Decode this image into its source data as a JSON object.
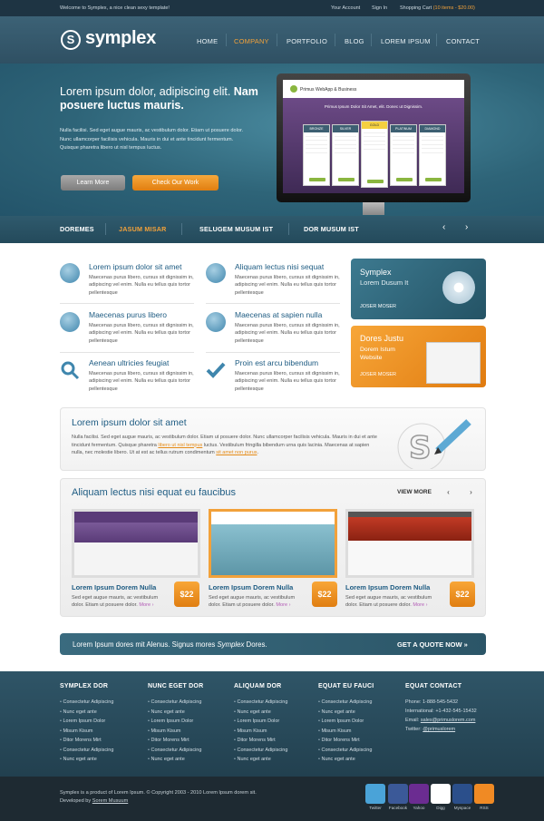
{
  "topbar": {
    "welcome": "Welcome to Symplex, a nice clean sexy template!",
    "my_account": "Your Account",
    "sign_in": "Sign In",
    "cart_label": "Shopping Cart",
    "cart_info": "(10 items - $20.00)"
  },
  "brand": {
    "name": "symplex",
    "mark": "S"
  },
  "nav": {
    "items": [
      "HOME",
      "COMPANY",
      "PORTFOLIO",
      "BLOG",
      "LOREM IPSUM",
      "CONTACT"
    ],
    "active": "COMPANY"
  },
  "hero": {
    "title_plain": "Lorem ipsum dolor, adipiscing elit.",
    "title_bold": "Nam posuere luctus mauris.",
    "body": "Nulla facilisi. Sed eget augue mauris, ac vestibulum dolor. Etiam ut posuere dolor. Nunc ullamcorper facilisis vehicula. Mauris in dui et ante tincidunt fermentum. Quisque pharetra libero ut nisl tempus luctus.",
    "learn_more": "Learn More",
    "check_work": "Check Our Work"
  },
  "screen": {
    "logo": "Primus WebApp & Business",
    "headline": "Primus Ipsum Dolor Sit Amet, elit. Donec ut Dignissim.",
    "plans": [
      "BRONZE",
      "SILVER",
      "GOLD",
      "PLATINUM",
      "DIAMOND"
    ]
  },
  "tabs": {
    "items": [
      "DOREMES",
      "JASUM MISAR",
      "SELUGEM MUSUM IST",
      "DOR MUSUM IST"
    ],
    "active": "JASUM MISAR"
  },
  "features": [
    {
      "title": "Lorem ipsum dolor sit amet",
      "text": "Maecenas purus libero, cursus sit dignissim in, adipiscing vel enim. Nulla eu tellus quis tortor pellentesque",
      "icon": "globe-icon"
    },
    {
      "title": "Aliquam lectus nisi sequat",
      "text": "Maecenas purus libero, cursus sit dignissim in, adipiscing vel enim. Nulla eu tellus quis tortor pellentesque",
      "icon": "download-icon"
    },
    {
      "title": "Maecenas purus libero",
      "text": "Maecenas purus libero, cursus sit dignissim in, adipiscing vel enim. Nulla eu tellus quis tortor pellentesque",
      "icon": "users-icon"
    },
    {
      "title": "Maecenas at sapien nulla",
      "text": "Maecenas purus libero, cursus sit dignissim in, adipiscing vel enim. Nulla eu tellus quis tortor pellentesque",
      "icon": "bug-icon"
    },
    {
      "title": "Aenean ultricies feugiat",
      "text": "Maecenas purus libero, cursus sit dignissim in, adipiscing vel enim. Nulla eu tellus quis tortor pellentesque",
      "icon": "search-icon"
    },
    {
      "title": "Proin est arcu bibendum",
      "text": "Maecenas purus libero, cursus sit dignissim in, adipiscing vel enim. Nulla eu tellus quis tortor pellentesque",
      "icon": "check-icon"
    }
  ],
  "promos": [
    {
      "title": "Symplex",
      "subtitle": "Lorem Dusum It",
      "author": "JOSER MOSER",
      "color": "#2e6a80"
    },
    {
      "title": "Dores Justu",
      "subtitle": "Dorem Istum Website",
      "author": "JOSER MOSER",
      "color": "#e88a1b"
    }
  ],
  "lorem": {
    "title": "Lorem ipsum dolor sit amet",
    "text_a": "Nulla facilisi. Sed eget augue mauris, ac vestibulum dolor. Etiam ut posuere dolor. Nunc ullamcorper facilisis vehicula. Mauris in dui et ante tincidunt fermentum. Quisque pharetra ",
    "link_a": "libero ut nisl tempus",
    "text_b": " luctus. Vestibulum fringilla bibendum urna quis lacinia. Maecenas at sapien nulla, nec molestie libero. Ut at est ac tellus rutrum condimentum ",
    "link_b": "sit amet non purus",
    "text_c": "."
  },
  "portfolio": {
    "title": "Aliquam lectus nisi equat eu faucibus",
    "view_more": "VIEW MORE",
    "items": [
      {
        "title": "Lorem Ipsum Dorem Nulla",
        "text": "Sed eget augue mauris, ac vestibulum dolor. Etiam ut posuere dolor.",
        "more": "More ›",
        "price": "$22"
      },
      {
        "title": "Lorem Ipsum Dorem Nulla",
        "text": "Sed eget augue mauris, ac vestibulum dolor. Etiam ut posuere dolor.",
        "more": "More ›",
        "price": "$22"
      },
      {
        "title": "Lorem Ipsum Dorem Nulla",
        "text": "Sed eget augue mauris, ac vestibulum dolor. Etiam ut posuere dolor.",
        "more": "More ›",
        "price": "$22"
      }
    ]
  },
  "cta": {
    "text_a": "Lorem Ipsum dores mit Alenus. Signus mores ",
    "text_em": "Symplex",
    "text_b": " Dores.",
    "button": "GET A QUOTE NOW »"
  },
  "footer": {
    "columns": [
      {
        "heading": "SYMPLEX DOR",
        "items": [
          "Consectetur Adipiscing",
          "Nunc eget ante",
          "Lorem Ipsum Dolor",
          "Misum Kisum",
          "Ditor Morens Mirt",
          "Consectetur Adipiscing",
          "Nunc eget ante"
        ]
      },
      {
        "heading": "NUNC EGET DOR",
        "items": [
          "Consectetur Adipiscing",
          "Nunc eget ante",
          "Lorem Ipsum Dolor",
          "Misum Kisum",
          "Ditor Morens Mirt",
          "Consectetur Adipiscing",
          "Nunc eget ante"
        ]
      },
      {
        "heading": "ALIQUAM DOR",
        "items": [
          "Consectetur Adipiscing",
          "Nunc eget ante",
          "Lorem Ipsum Dolor",
          "Misum Kisum",
          "Ditor Morens Mirt",
          "Consectetur Adipiscing",
          "Nunc eget ante"
        ]
      },
      {
        "heading": "EQUAT EU FAUCI",
        "items": [
          "Consectetur Adipiscing",
          "Nunc eget ante",
          "Lorem Ipsum Dolor",
          "Misum Kisum",
          "Ditor Morens Mirt",
          "Consectetur Adipiscing",
          "Nunc eget ante"
        ]
      }
    ],
    "contact": {
      "heading": "EQUAT CONTACT",
      "phone": "Phone: 1-888-545-5432",
      "intl": "International: +1-432-545-15432",
      "email_label": "Email: ",
      "email": "sales@primuslorem.com",
      "twitter_label": "Twitter: ",
      "twitter": "@primuslorem"
    }
  },
  "bottom": {
    "copyright": "Symplex is a product of Lorem Ipsum. © Copyright 2003 - 2010 Lorem Ipsum dorem sit.",
    "dev_label": "Developed by ",
    "dev": "Sorem Musuum",
    "social": [
      {
        "label": "Twitter",
        "color": "#4aa3d8"
      },
      {
        "label": "Facebook",
        "color": "#3b5998"
      },
      {
        "label": "Yahoo",
        "color": "#6b2c91"
      },
      {
        "label": "Digg",
        "color": "#ffffff"
      },
      {
        "label": "Myspace",
        "color": "#2b4f8b"
      },
      {
        "label": "RSS",
        "color": "#f08a24"
      }
    ]
  }
}
